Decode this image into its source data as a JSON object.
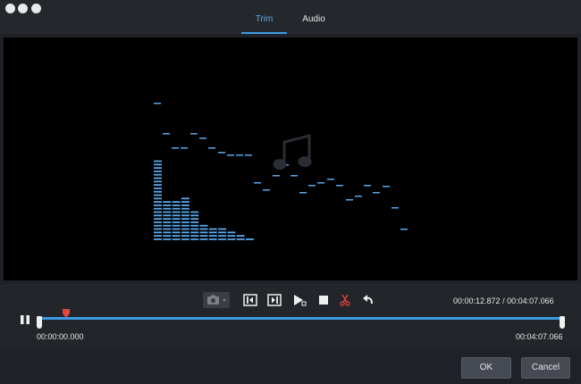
{
  "window": {
    "tabs": [
      {
        "label": "Trim",
        "active": true
      },
      {
        "label": "Audio",
        "active": false
      }
    ]
  },
  "player": {
    "current_time": "00:00:12.872",
    "separator": "/",
    "duration": "00:04:07.066",
    "trim_start": "00:00:00.000",
    "trim_end": "00:04:07.066",
    "playhead_fraction": 0.052
  },
  "toolbar": {
    "icons": [
      "camera-icon",
      "set-start-icon",
      "set-end-icon",
      "play-segment-icon",
      "stop-icon",
      "scissors-icon",
      "undo-icon"
    ]
  },
  "footer": {
    "ok_label": "OK",
    "cancel_label": "Cancel"
  },
  "colors": {
    "accent": "#3f9be4",
    "marker": "#e6453c",
    "visualizer": "#58a8ec"
  }
}
